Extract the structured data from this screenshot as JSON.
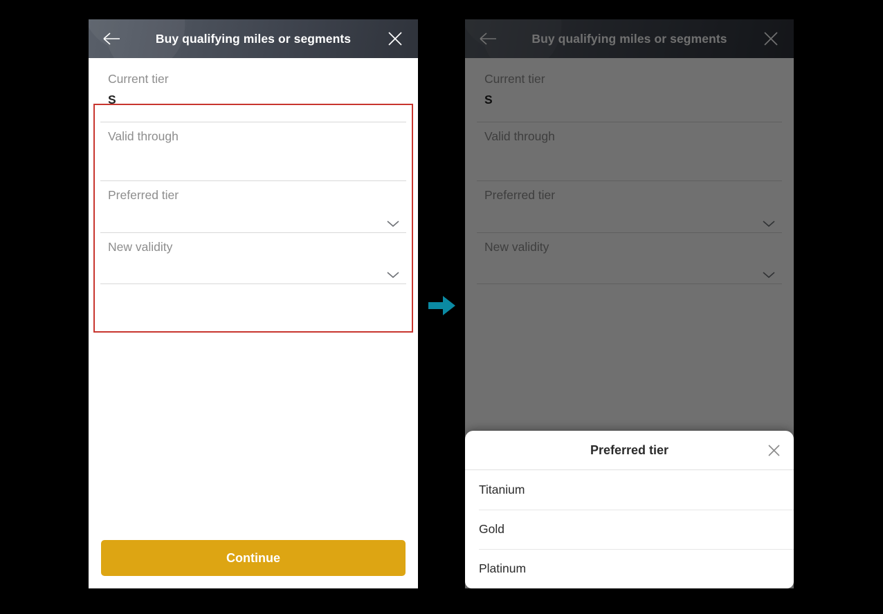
{
  "theme": {
    "accent_button": "#dda513",
    "annotation_border": "#c8352e",
    "arrow": "#0b8aa3",
    "header_dark": "#3e434d",
    "page_background": "#000000"
  },
  "arrow": {
    "icon": "arrow-right-icon"
  },
  "screen_before": {
    "header": {
      "back_icon": "arrow-left-icon",
      "title": "Buy qualifying miles or segments",
      "close_icon": "close-icon"
    },
    "form": {
      "fields": [
        {
          "label": "Current tier",
          "value": "S",
          "icon": ""
        },
        {
          "label": "Valid through",
          "value": "",
          "icon": ""
        },
        {
          "label": "Preferred tier",
          "value": "",
          "icon": "chevron-down-icon"
        },
        {
          "label": "New validity",
          "value": "",
          "icon": "chevron-down-icon"
        }
      ]
    },
    "cta": {
      "label": "Continue"
    }
  },
  "screen_after": {
    "header": {
      "back_icon": "arrow-left-icon",
      "title": "Buy qualifying miles or segments",
      "close_icon": "close-icon"
    },
    "form": {
      "fields": [
        {
          "label": "Current tier",
          "value": "S",
          "icon": ""
        },
        {
          "label": "Valid through",
          "value": "",
          "icon": ""
        },
        {
          "label": "Preferred tier",
          "value": "",
          "icon": "chevron-down-icon"
        },
        {
          "label": "New validity",
          "value": "",
          "icon": "chevron-down-icon"
        }
      ]
    },
    "sheet": {
      "title": "Preferred tier",
      "close_icon": "close-icon",
      "options": [
        {
          "label": "Titanium"
        },
        {
          "label": "Gold"
        },
        {
          "label": "Platinum"
        }
      ]
    }
  }
}
